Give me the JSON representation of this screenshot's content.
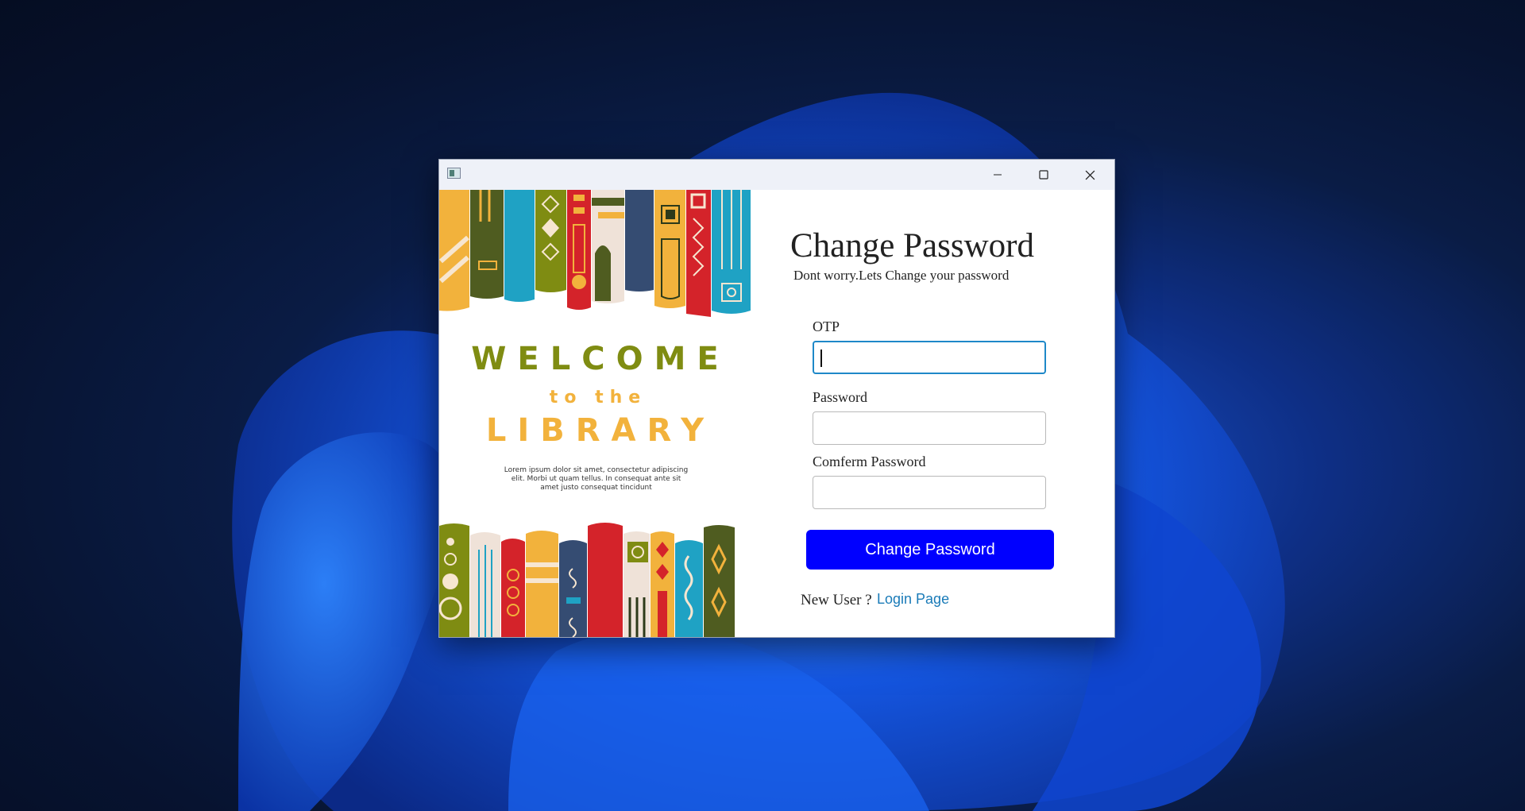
{
  "colors": {
    "accent": "#0000ff",
    "link": "#1a7bb8",
    "focus_border": "#1e88c8",
    "welcome_green": "#7f8c12",
    "welcome_orange": "#f2b23c"
  },
  "titlebar": {
    "app_icon": "app-window-icon",
    "minimize_icon": "minimize-icon",
    "maximize_icon": "maximize-icon",
    "close_icon": "close-icon"
  },
  "art": {
    "welcome": "WELCOME",
    "to_the": "to the",
    "library": "LIBRARY",
    "lorem": "Lorem ipsum dolor sit amet, consectetur adipiscing elit. Morbi ut quam tellus. In consequat ante sit amet justo consequat tincidunt"
  },
  "form": {
    "title": "Change Password",
    "subtitle": "Dont worry.Lets Change your password",
    "otp_label": "OTP",
    "otp_value": "",
    "password_label": "Password",
    "password_value": "",
    "confirm_label": "Comferm Password",
    "confirm_value": "",
    "submit_label": "Change Password",
    "new_user_text": "New User ?",
    "login_link": "Login Page"
  }
}
